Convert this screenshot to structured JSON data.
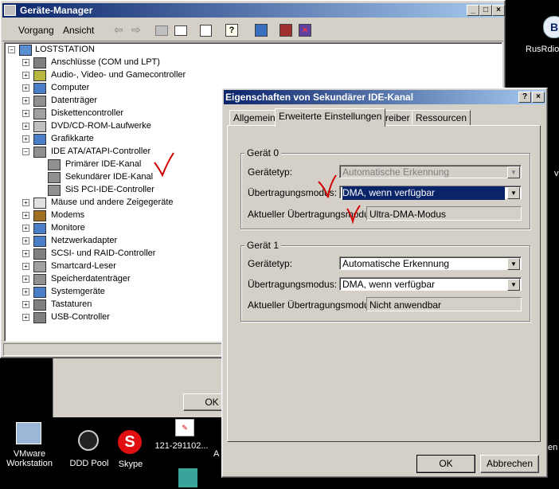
{
  "devmgr": {
    "title": "Geräte-Manager",
    "menu": [
      "Vorgang",
      "Ansicht"
    ],
    "root": "LOSTSTATION",
    "items": [
      {
        "label": "Anschlüsse (COM und LPT)",
        "exp": "+"
      },
      {
        "label": "Audio-, Video- und Gamecontroller",
        "exp": "+"
      },
      {
        "label": "Computer",
        "exp": "+"
      },
      {
        "label": "Datenträger",
        "exp": "+"
      },
      {
        "label": "Diskettencontroller",
        "exp": "+"
      },
      {
        "label": "DVD/CD-ROM-Laufwerke",
        "exp": "+"
      },
      {
        "label": "Grafikkarte",
        "exp": "+"
      },
      {
        "label": "IDE ATA/ATAPI-Controller",
        "exp": "−"
      },
      {
        "label": "Primärer IDE-Kanal",
        "exp": ""
      },
      {
        "label": "Sekundärer IDE-Kanal",
        "exp": ""
      },
      {
        "label": "SiS PCI-IDE-Controller",
        "exp": ""
      },
      {
        "label": "Mäuse und andere Zeigegeräte",
        "exp": "+"
      },
      {
        "label": "Modems",
        "exp": "+"
      },
      {
        "label": "Monitore",
        "exp": "+"
      },
      {
        "label": "Netzwerkadapter",
        "exp": "+"
      },
      {
        "label": "SCSI- und RAID-Controller",
        "exp": "+"
      },
      {
        "label": "Smartcard-Leser",
        "exp": "+"
      },
      {
        "label": "Speicherdatenträger",
        "exp": "+"
      },
      {
        "label": "Systemgeräte",
        "exp": "+"
      },
      {
        "label": "Tastaturen",
        "exp": "+"
      },
      {
        "label": "USB-Controller",
        "exp": "+"
      }
    ],
    "behind_ok": "OK"
  },
  "dialog": {
    "title": "Eigenschaften von Sekundärer IDE-Kanal",
    "help": "?",
    "close": "×",
    "tabs": [
      "Allgemein",
      "Erweiterte Einstellungen",
      "Treiber",
      "Ressourcen"
    ],
    "active_tab": 1,
    "group0": {
      "title": "Gerät 0",
      "type_label": "Gerätetyp:",
      "type_value": "Automatische Erkennung",
      "mode_label": "Übertragungsmodus:",
      "mode_value": "DMA, wenn verfügbar",
      "current_label": "Aktueller Übertragungsmodus:",
      "current_value": "Ultra-DMA-Modus"
    },
    "group1": {
      "title": "Gerät 1",
      "type_label": "Gerätetyp:",
      "type_value": "Automatische Erkennung",
      "mode_label": "Übertragungsmodus:",
      "mode_value": "DMA, wenn verfügbar",
      "current_label": "Aktueller Übertragungsmodus:",
      "current_value": "Nicht anwendbar"
    },
    "ok": "OK",
    "cancel": "Abbrechen"
  },
  "desktop": {
    "icons": [
      {
        "label": "VMware\nWorkstation"
      },
      {
        "label": "DDD Pool"
      },
      {
        "label": "Skype"
      },
      {
        "label": "121-291102..."
      },
      {
        "label": "RusRdio"
      }
    ],
    "clip_text_a": "A",
    "clip_text_v": "v",
    "clip_text_en": "en"
  },
  "colors": {
    "selection": "#0a246a",
    "titlebar": "#0a246a",
    "face": "#d4d0c8",
    "annotation": "#d00000"
  }
}
